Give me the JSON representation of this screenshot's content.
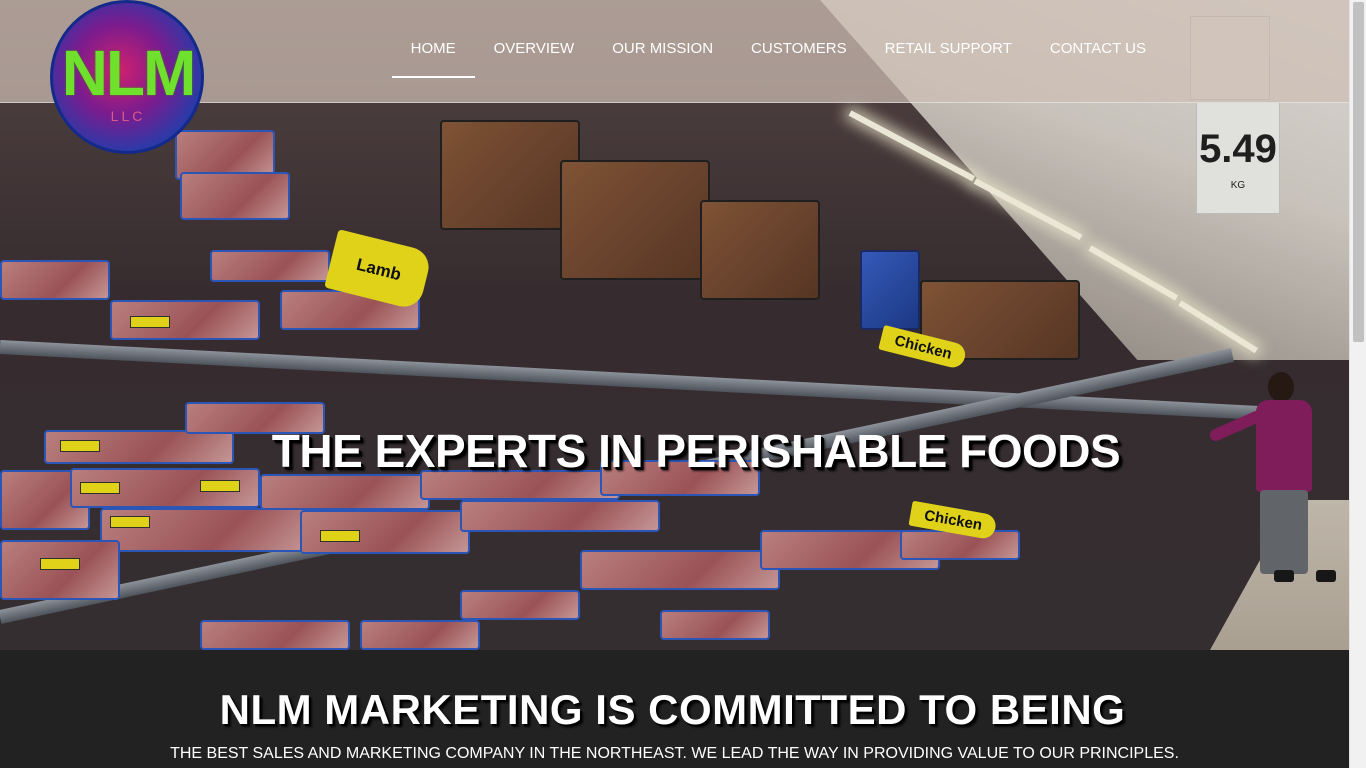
{
  "brand": {
    "logo_text": "NLM",
    "logo_sub": "LLC",
    "colors": {
      "logo_green": "#6fe02b",
      "header_overlay": "#cdbeb4",
      "section_bg": "#222222"
    }
  },
  "nav": {
    "items": [
      {
        "label": "HOME",
        "active": true
      },
      {
        "label": "OVERVIEW",
        "active": false
      },
      {
        "label": "OUR MISSION",
        "active": false
      },
      {
        "label": "CUSTOMERS",
        "active": false
      },
      {
        "label": "RETAIL SUPPORT",
        "active": false
      },
      {
        "label": "CONTACT US",
        "active": false
      }
    ]
  },
  "hero": {
    "title": "THE EXPERTS IN PERISHABLE FOODS",
    "shelf_tags": {
      "lamb": "Lamb",
      "chicken": "Chicken",
      "chicken2": "Chicken"
    },
    "price_sign": {
      "price": "5.49",
      "unit": "KG"
    }
  },
  "section": {
    "title": "NLM MARKETING IS COMMITTED TO BEING",
    "subtitle": "THE BEST SALES AND MARKETING COMPANY IN THE NORTHEAST. WE LEAD THE WAY IN PROVIDING VALUE TO OUR PRINCIPLES."
  }
}
